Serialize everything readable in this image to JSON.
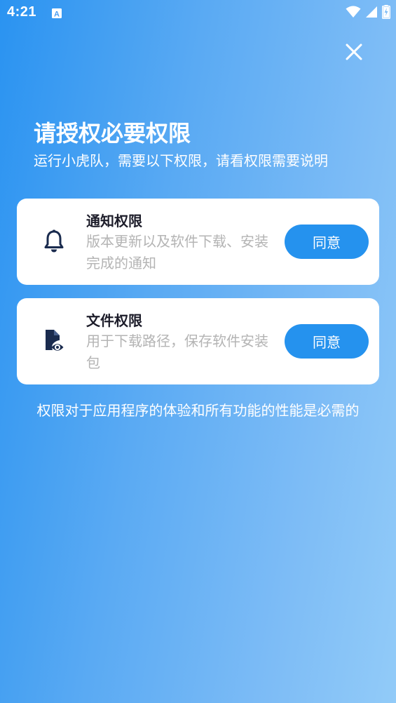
{
  "status_bar": {
    "time": "4:21",
    "icons": [
      "app-notification-icon",
      "wifi-icon",
      "cellular-signal-icon",
      "battery-charging-icon"
    ]
  },
  "dialog": {
    "close_icon": "close-icon",
    "title": "请授权必要权限",
    "subtitle": "运行小虎队，需要以下权限，请看权限需要说明",
    "permissions": [
      {
        "icon": "bell-icon",
        "title": "通知权限",
        "description": "版本更新以及软件下载、安装完成的通知",
        "button_label": "同意"
      },
      {
        "icon": "file-view-icon",
        "title": "文件权限",
        "description": "用于下载路径，保存软件安装包",
        "button_label": "同意"
      }
    ],
    "footer_note": "权限对于应用程序的体验和所有功能的性能是必需的"
  },
  "colors": {
    "gradient_start": "#2a93f1",
    "gradient_end": "#92cbf8",
    "button": "#2592ee",
    "card_title": "#1d1d2a",
    "card_desc": "#b4b4b4",
    "icon": "#1a2b4e"
  }
}
